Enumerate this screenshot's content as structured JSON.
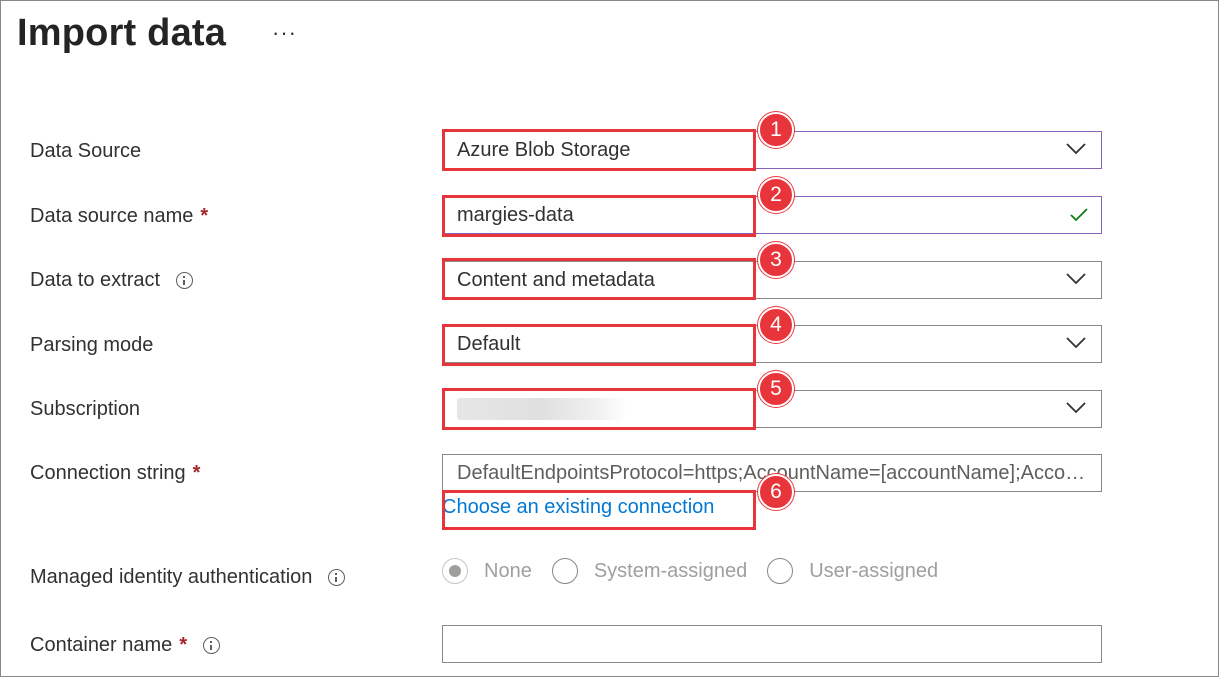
{
  "page": {
    "title": "Import data",
    "more_label": "···"
  },
  "fields": {
    "data_source": {
      "label": "Data Source",
      "value": "Azure Blob Storage"
    },
    "data_source_name": {
      "label": "Data source name",
      "required_mark": "*",
      "value": "margies-data"
    },
    "data_to_extract": {
      "label": "Data to extract",
      "value": "Content and metadata"
    },
    "parsing_mode": {
      "label": "Parsing mode",
      "value": "Default"
    },
    "subscription": {
      "label": "Subscription",
      "value": ""
    },
    "connection_string": {
      "label": "Connection string",
      "required_mark": "*",
      "value": "DefaultEndpointsProtocol=https;AccountName=[accountName];AccountKey=[accountKey]"
    },
    "existing_connection_link": "Choose an existing connection",
    "managed_identity": {
      "label": "Managed identity authentication",
      "options": [
        "None",
        "System-assigned",
        "User-assigned"
      ],
      "selected": "None"
    },
    "container_name": {
      "label": "Container name",
      "required_mark": "*",
      "value": ""
    }
  },
  "annotations": [
    "1",
    "2",
    "3",
    "4",
    "5",
    "6"
  ],
  "colors": {
    "annotation": "#e8353b",
    "link": "#0078d4",
    "focus_border": "#8764b8",
    "valid_check": "#107c10"
  }
}
